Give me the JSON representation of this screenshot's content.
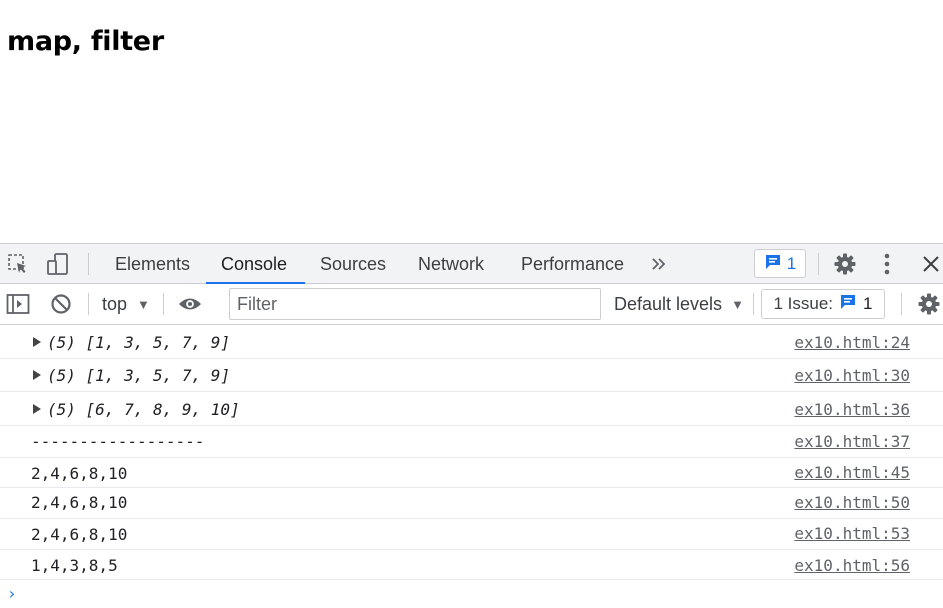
{
  "page": {
    "heading": "map, filter"
  },
  "devtools": {
    "tabs": [
      "Elements",
      "Console",
      "Sources",
      "Network",
      "Performance"
    ],
    "messages_badge": "1",
    "console_toolbar": {
      "context": "top",
      "filter_placeholder": "Filter",
      "levels": "Default levels",
      "issues_label": "1 Issue:",
      "issues_count": "1"
    },
    "console": [
      {
        "kind": "array",
        "length": "(5)",
        "values": [
          "1",
          "3",
          "5",
          "7",
          "9"
        ],
        "source": "ex10.html:24"
      },
      {
        "kind": "array",
        "length": "(5)",
        "values": [
          "1",
          "3",
          "5",
          "7",
          "9"
        ],
        "source": "ex10.html:30"
      },
      {
        "kind": "array",
        "length": "(5)",
        "values": [
          "6",
          "7",
          "8",
          "9",
          "10"
        ],
        "source": "ex10.html:36"
      },
      {
        "kind": "text",
        "text": "------------------",
        "source": "ex10.html:37"
      },
      {
        "kind": "text",
        "text": "2,4,6,8,10",
        "source": "ex10.html:45"
      },
      {
        "kind": "text",
        "text": "2,4,6,8,10",
        "source": "ex10.html:50"
      },
      {
        "kind": "text",
        "text": "2,4,6,8,10",
        "source": "ex10.html:53"
      },
      {
        "kind": "text",
        "text": "1,4,3,8,5",
        "source": "ex10.html:56"
      }
    ],
    "prompt_symbol": "›"
  },
  "colors": {
    "accent": "#1a73e8",
    "number": "#1a1aa6",
    "toolbar_bg": "#f1f3f4",
    "border": "#cbcdd1"
  },
  "icons": [
    "inspect-element-icon",
    "device-toolbar-icon",
    "more-tabs-icon",
    "message-icon",
    "settings-icon",
    "more-options-icon",
    "close-icon",
    "sidebar-toggle-icon",
    "clear-console-icon",
    "dropdown-arrow-icon",
    "live-expression-eye-icon"
  ]
}
